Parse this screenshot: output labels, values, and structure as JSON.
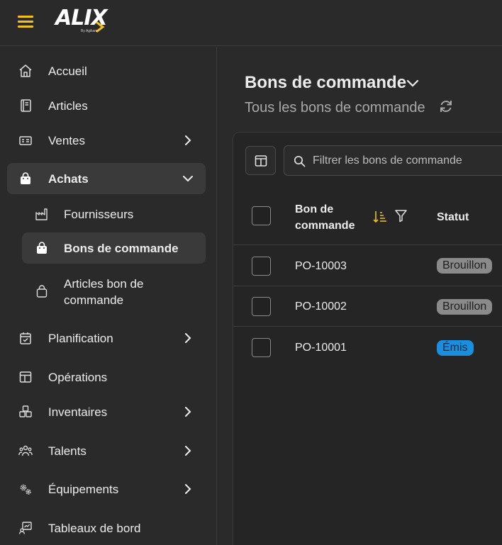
{
  "header": {
    "logo_text": "ALIX",
    "logo_sub": "By Agiliam",
    "accent": "#f2c21b"
  },
  "sidebar": {
    "items": [
      {
        "label": "Accueil",
        "icon": "home-icon"
      },
      {
        "label": "Articles",
        "icon": "book-icon"
      },
      {
        "label": "Ventes",
        "icon": "card-icon",
        "chevron": "right"
      },
      {
        "label": "Achats",
        "icon": "bag-icon",
        "chevron": "down",
        "active": true
      },
      {
        "label": "Planification",
        "icon": "calendar-icon",
        "chevron": "right"
      },
      {
        "label": "Opérations",
        "icon": "layout-icon"
      },
      {
        "label": "Inventaires",
        "icon": "boxes-icon",
        "chevron": "right"
      },
      {
        "label": "Talents",
        "icon": "people-icon",
        "chevron": "right"
      },
      {
        "label": "Équipements",
        "icon": "gears-icon",
        "chevron": "right"
      },
      {
        "label": "Tableaux de bord",
        "icon": "dashboard-icon"
      }
    ],
    "subitems": [
      {
        "label": "Fournisseurs",
        "icon": "factory-icon"
      },
      {
        "label": "Bons de commande",
        "icon": "bag-icon",
        "active": true
      },
      {
        "label": "Articles bon de commande",
        "icon": "bag-outline-icon"
      }
    ]
  },
  "main": {
    "title": "Bons de commande",
    "subtitle": "Tous les bons de commande",
    "search_placeholder": "Filtrer les bons de commande",
    "columns": {
      "po": "Bon de commande",
      "status": "Statut"
    },
    "rows": [
      {
        "po": "PO-10003",
        "status": "Brouillon",
        "status_color": "#8a8a8a"
      },
      {
        "po": "PO-10002",
        "status": "Brouillon",
        "status_color": "#8a8a8a"
      },
      {
        "po": "PO-10001",
        "status": "Émis",
        "status_color": "#1a8fe0"
      }
    ]
  }
}
